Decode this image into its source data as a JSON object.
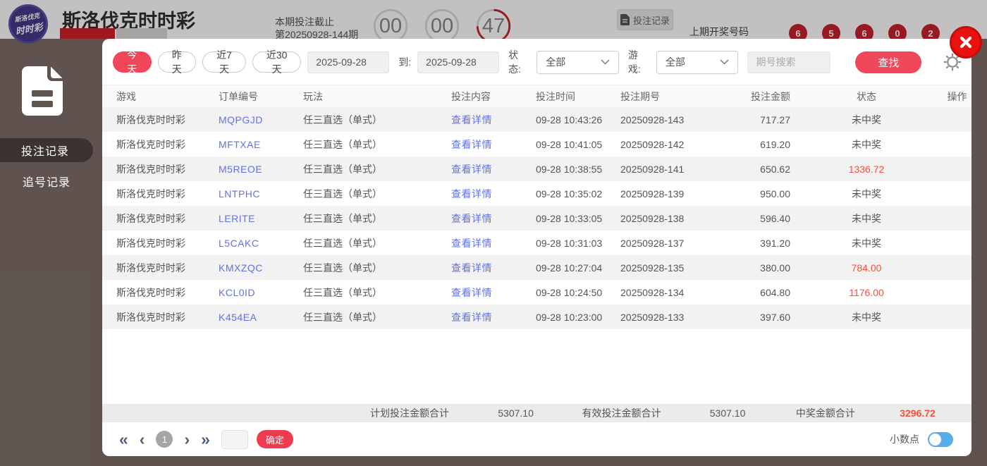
{
  "header": {
    "title": "斯洛伐克时时彩",
    "deadline_label": "本期投注截止",
    "deadline_period": "第20250928-144期",
    "countdown": [
      "00",
      "00",
      "47"
    ],
    "bet_record_button": "投注记录",
    "last_draw_label": "上期开奖号码",
    "last_draw_numbers": [
      "6",
      "5",
      "6",
      "0",
      "2"
    ]
  },
  "sidebar": {
    "items": [
      {
        "label": "投注记录",
        "active": true
      },
      {
        "label": "追号记录",
        "active": false
      }
    ]
  },
  "filters": {
    "quick_ranges": [
      {
        "label": "今天",
        "active": true
      },
      {
        "label": "昨天",
        "active": false
      },
      {
        "label": "近7天",
        "active": false
      },
      {
        "label": "近30天",
        "active": false
      }
    ],
    "date_from": "2025-09-28",
    "to_label": "到:",
    "date_to": "2025-09-28",
    "status_label": "状态:",
    "status_value": "全部",
    "game_label": "游戏:",
    "game_value": "全部",
    "period_search_placeholder": "期号搜索",
    "search_button": "查找"
  },
  "table": {
    "headers": [
      "游戏",
      "订单编号",
      "玩法",
      "投注内容",
      "投注时间",
      "投注期号",
      "投注金额",
      "状态",
      "操作"
    ],
    "detail_link": "查看详情",
    "rows": [
      {
        "game": "斯洛伐克时时彩",
        "order_no": "MQPGJD",
        "play": "任三直选（单式）",
        "time": "09-28 10:43:26",
        "period": "20250928-143",
        "amount": "717.27",
        "status": "未中奖",
        "won": false
      },
      {
        "game": "斯洛伐克时时彩",
        "order_no": "MFTXAE",
        "play": "任三直选（单式）",
        "time": "09-28 10:41:05",
        "period": "20250928-142",
        "amount": "619.20",
        "status": "未中奖",
        "won": false
      },
      {
        "game": "斯洛伐克时时彩",
        "order_no": "M5REOE",
        "play": "任三直选（单式）",
        "time": "09-28 10:38:55",
        "period": "20250928-141",
        "amount": "650.62",
        "status": "1336.72",
        "won": true
      },
      {
        "game": "斯洛伐克时时彩",
        "order_no": "LNTPHC",
        "play": "任三直选（单式）",
        "time": "09-28 10:35:02",
        "period": "20250928-139",
        "amount": "950.00",
        "status": "未中奖",
        "won": false
      },
      {
        "game": "斯洛伐克时时彩",
        "order_no": "LERITE",
        "play": "任三直选（单式）",
        "time": "09-28 10:33:05",
        "period": "20250928-138",
        "amount": "596.40",
        "status": "未中奖",
        "won": false
      },
      {
        "game": "斯洛伐克时时彩",
        "order_no": "L5CAKC",
        "play": "任三直选（单式）",
        "time": "09-28 10:31:03",
        "period": "20250928-137",
        "amount": "391.20",
        "status": "未中奖",
        "won": false
      },
      {
        "game": "斯洛伐克时时彩",
        "order_no": "KMXZQC",
        "play": "任三直选（单式）",
        "time": "09-28 10:27:04",
        "period": "20250928-135",
        "amount": "380.00",
        "status": "784.00",
        "won": true
      },
      {
        "game": "斯洛伐克时时彩",
        "order_no": "KCL0ID",
        "play": "任三直选（单式）",
        "time": "09-28 10:24:50",
        "period": "20250928-134",
        "amount": "604.80",
        "status": "1176.00",
        "won": true
      },
      {
        "game": "斯洛伐克时时彩",
        "order_no": "K454EA",
        "play": "任三直选（单式）",
        "time": "09-28 10:23:00",
        "period": "20250928-133",
        "amount": "397.60",
        "status": "未中奖",
        "won": false
      }
    ]
  },
  "summary": {
    "planned_label": "计划投注金额合计",
    "planned_value": "5307.10",
    "valid_label": "有效投注金额合计",
    "valid_value": "5307.10",
    "win_label": "中奖金额合计",
    "win_value": "3296.72"
  },
  "pagination": {
    "current_page": "1",
    "confirm_button": "确定",
    "decimal_label": "小数点"
  },
  "colors": {
    "accent_red": "#f0475a",
    "link_blue": "#6272e2",
    "win_red": "#f4503c",
    "toggle_blue": "#58ace8"
  }
}
